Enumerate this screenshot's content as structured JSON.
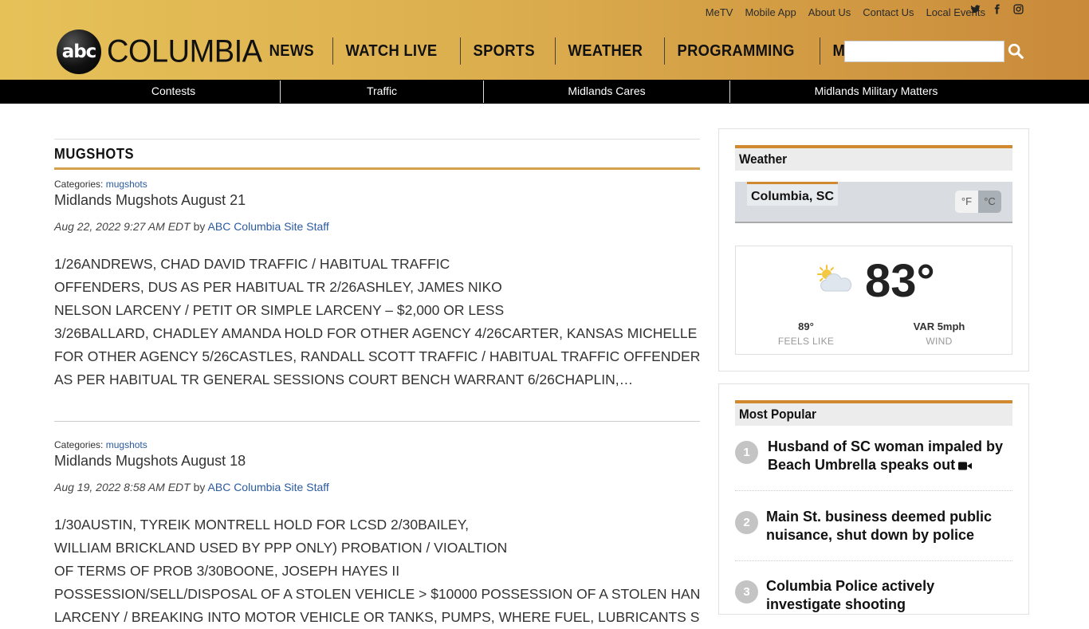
{
  "header": {
    "util_links": [
      "MeTV",
      "Mobile App",
      "About Us",
      "Contact Us",
      "Local Events"
    ],
    "social_icons": [
      "twitter-icon",
      "facebook-icon",
      "instagram-icon"
    ],
    "logo_abc": "abc",
    "logo_text": "COLUMBIA",
    "nav": [
      "NEWS",
      "WATCH LIVE",
      "SPORTS",
      "WEATHER",
      "PROGRAMMING",
      "MUGSHOTS"
    ],
    "search": {
      "placeholder": "",
      "value": ""
    }
  },
  "subnav": [
    "Contests",
    "Traffic",
    "Midlands Cares",
    "Midlands Military Matters"
  ],
  "main": {
    "section_title": "MUGSHOTS",
    "categories_label": "Categories:",
    "by_label": "by",
    "articles": [
      {
        "category": "mugshots",
        "title": "Midlands Mugshots August 21",
        "date": "Aug 22, 2022 9:27 AM EDT",
        "author": "ABC Columbia Site Staff",
        "excerpt_lines": [
          "1/26ANDREWS, CHAD DAVID TRAFFIC / HABITUAL TRAFFIC",
          "OFFENDERS, DUS AS PER HABITUAL TR 2/26ASHLEY, JAMES NIKO",
          "NELSON LARCENY / PETIT OR SIMPLE LARCENY – $2,000 OR LESS",
          "3/26BALLARD, CHADLEY AMANDA HOLD FOR OTHER AGENCY 4/26CARTER, KANSAS MICHELLE HOLD",
          "FOR OTHER AGENCY 5/26CASTLES, RANDALL SCOTT TRAFFIC / HABITUAL TRAFFIC OFFENDERS, DUS",
          "AS PER HABITUAL TR GENERAL SESSIONS COURT BENCH WARRANT 6/26CHAPLIN,…"
        ]
      },
      {
        "category": "mugshots",
        "title": "Midlands Mugshots August 18",
        "date": "Aug 19, 2022 8:58 AM EDT",
        "author": "ABC Columbia Site Staff",
        "excerpt_lines": [
          "1/30AUSTIN, TYREIK MONTRELL HOLD FOR LCSD 2/30BAILEY,",
          "WILLIAM BRICKLAND USED BY PPP ONLY) PROBATION / VIOALTION",
          "OF TERMS OF PROB 3/30BOONE, JOSEPH HAYES II",
          "POSSESSION/SELL/DISPOSAL OF A STOLEN VEHICLE > $10000 POSSESSION OF A STOLEN HANDGUN",
          "LARCENY / BREAKING INTO MOTOR VEHICLE OR TANKS, PUMPS, WHERE FUEL, LUBRICANTS STORED"
        ]
      }
    ]
  },
  "sidebar": {
    "weather": {
      "title": "Weather",
      "location": "Columbia, SC",
      "unit_f": "°F",
      "unit_c": "°C",
      "temp": "83°",
      "condition_icon": "partly-cloudy-icon",
      "feels_like_value": "89°",
      "feels_like_label": "FEELS LIKE",
      "wind_value": "VAR 5mph",
      "wind_label": "WIND"
    },
    "popular": {
      "title": "Most Popular",
      "items": [
        {
          "num": "1",
          "text": "Husband of SC woman impaled by Beach Umbrella speaks out",
          "video": true
        },
        {
          "num": "2",
          "text": "Main St. business deemed public nuisance, shut down by police",
          "video": false
        },
        {
          "num": "3",
          "text": "Columbia Police actively investigate shooting",
          "video": false
        }
      ]
    }
  },
  "colors": {
    "header_gold": "#e6c158",
    "header_orange": "#c98a3a",
    "accent_orange": "#d0892e",
    "link_blue": "#2a5aa0"
  }
}
